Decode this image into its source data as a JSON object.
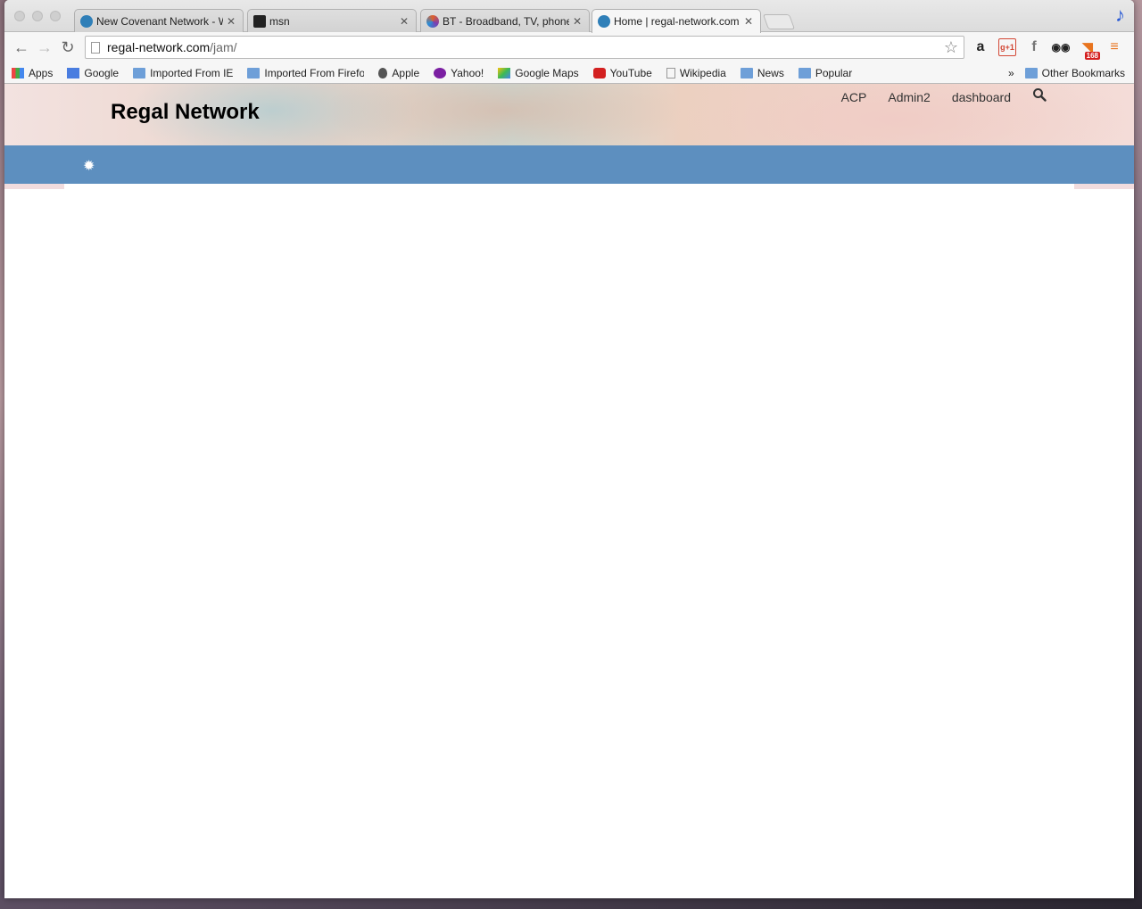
{
  "browser": {
    "tabs": [
      {
        "title": "New Covenant Network - W",
        "favicon_color": "#2f7fb8"
      },
      {
        "title": "msn",
        "favicon_color": "#222222"
      },
      {
        "title": "BT - Broadband, TV, phone",
        "favicon_color": "#e0602a"
      },
      {
        "title": "Home | regal-network.com",
        "favicon_color": "#2f7fb8"
      }
    ],
    "active_tab": 3,
    "url_host": "regal-network.com",
    "url_path": "/jam/",
    "bookmarks": [
      {
        "label": "Apps",
        "icon": "apps-grid-icon"
      },
      {
        "label": "Google",
        "icon": "google-icon"
      },
      {
        "label": "Imported From IE",
        "icon": "folder-icon"
      },
      {
        "label": "Imported From Firefo",
        "icon": "folder-icon"
      },
      {
        "label": "Apple",
        "icon": "apple-icon"
      },
      {
        "label": "Yahoo!",
        "icon": "yahoo-icon"
      },
      {
        "label": "Google Maps",
        "icon": "maps-icon"
      },
      {
        "label": "YouTube",
        "icon": "youtube-icon"
      },
      {
        "label": "Wikipedia",
        "icon": "page-icon"
      },
      {
        "label": "News",
        "icon": "folder-icon"
      },
      {
        "label": "Popular",
        "icon": "folder-icon"
      }
    ],
    "bookmarks_overflow": "»",
    "other_bookmarks": "Other Bookmarks",
    "rss_badge": "168"
  },
  "site": {
    "title": "Regal Network",
    "nav": [
      "ACP",
      "Admin2",
      "dashboard"
    ],
    "accent": "#5d8fbf"
  }
}
